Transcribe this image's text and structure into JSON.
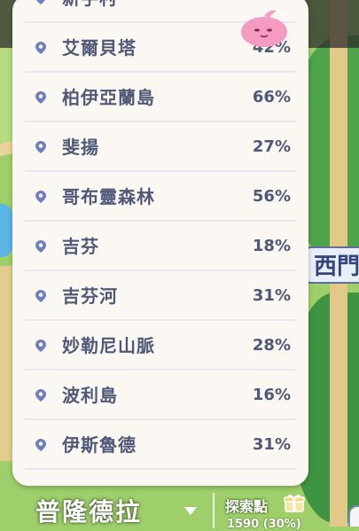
{
  "regions": [
    {
      "name": "新手村",
      "percent": ""
    },
    {
      "name": "艾爾貝塔",
      "percent": "42%"
    },
    {
      "name": "柏伊亞蘭島",
      "percent": "66%"
    },
    {
      "name": "斐揚",
      "percent": "27%"
    },
    {
      "name": "哥布靈森林",
      "percent": "56%"
    },
    {
      "name": "吉芬",
      "percent": "18%"
    },
    {
      "name": "吉芬河",
      "percent": "31%"
    },
    {
      "name": "妙勒尼山脈",
      "percent": "28%"
    },
    {
      "name": "波利島",
      "percent": "16%"
    },
    {
      "name": "伊斯魯德",
      "percent": "31%"
    }
  ],
  "map_sign": "西門",
  "footer": {
    "current_region": "普隆德拉",
    "explore_label": "探索點",
    "explore_value": "1590 (30%)"
  },
  "icons": {
    "location": "map-pin-icon",
    "mascot": "poring-icon",
    "dropdown": "caret-down-icon",
    "gift": "gift-icon"
  },
  "colors": {
    "panel_bg": "#fbf8f3",
    "text": "#4f5878",
    "pin": "#6f7fc0",
    "mascot": "#f59ac0"
  }
}
